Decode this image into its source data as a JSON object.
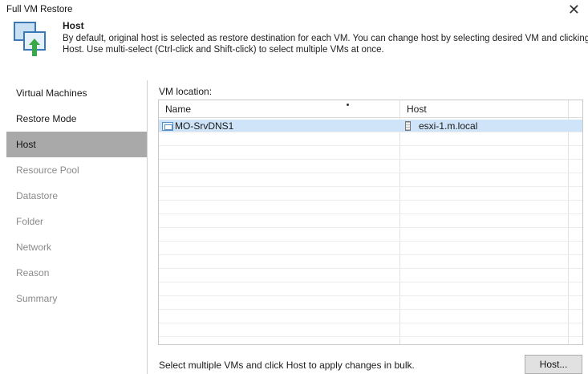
{
  "window": {
    "title": "Full VM Restore",
    "close_icon": "close-icon"
  },
  "header": {
    "icon": "host-restore-icon",
    "title": "Host",
    "description": "By default, original host is selected as restore destination for each VM. You can change host by selecting desired VM and clicking Host. Use multi-select (Ctrl-click and Shift-click) to select multiple VMs at once."
  },
  "sidebar": {
    "steps": [
      {
        "label": "Virtual Machines",
        "state": "completed"
      },
      {
        "label": "Restore Mode",
        "state": "completed"
      },
      {
        "label": "Host",
        "state": "active"
      },
      {
        "label": "Resource Pool",
        "state": "disabled"
      },
      {
        "label": "Datastore",
        "state": "disabled"
      },
      {
        "label": "Folder",
        "state": "disabled"
      },
      {
        "label": "Network",
        "state": "disabled"
      },
      {
        "label": "Reason",
        "state": "disabled"
      },
      {
        "label": "Summary",
        "state": "disabled"
      }
    ]
  },
  "main": {
    "section_label": "VM location:",
    "table": {
      "columns": [
        "Name",
        "Host"
      ],
      "rows": [
        {
          "name": "MO-SrvDNS1",
          "host": "esxi-1.m.local",
          "selected": true,
          "name_icon": "vm-icon",
          "host_icon": "host-server-icon"
        }
      ]
    },
    "footer_text": "Select multiple VMs and click Host to apply changes in bulk.",
    "host_button_label": "Host..."
  },
  "colors": {
    "selected_row": "#cfe4f8",
    "active_step": "#a9a9a9",
    "disabled_text": "#8a8a8a"
  }
}
